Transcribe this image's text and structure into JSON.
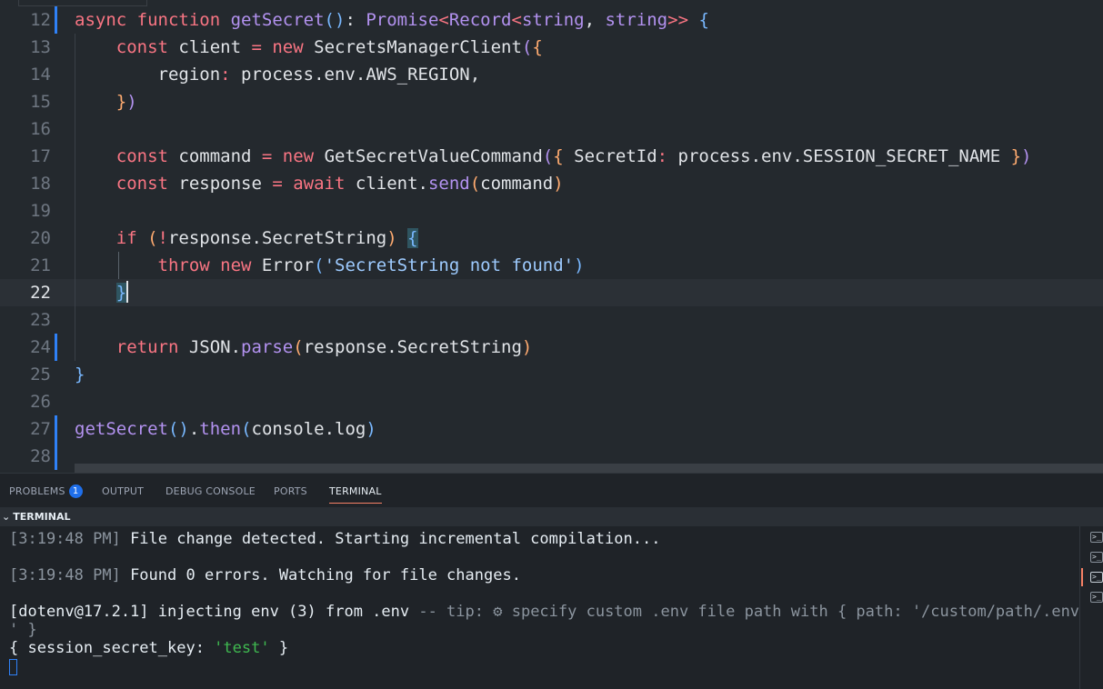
{
  "editor": {
    "current_line": "22",
    "lines": [
      {
        "num": "12",
        "tokens": [
          {
            "t": "async ",
            "c": "kw"
          },
          {
            "t": "function ",
            "c": "kw"
          },
          {
            "t": "getSecret",
            "c": "fn"
          },
          {
            "t": "()",
            "c": "b1"
          },
          {
            "t": ": ",
            "c": "var"
          },
          {
            "t": "Promise",
            "c": "ty"
          },
          {
            "t": "<",
            "c": "kw"
          },
          {
            "t": "Record",
            "c": "ty"
          },
          {
            "t": "<",
            "c": "kw"
          },
          {
            "t": "string",
            "c": "ty"
          },
          {
            "t": ", ",
            "c": "var"
          },
          {
            "t": "string",
            "c": "ty"
          },
          {
            "t": ">>",
            "c": "kw"
          },
          {
            "t": " ",
            "c": "var"
          },
          {
            "t": "{",
            "c": "b1"
          }
        ]
      },
      {
        "num": "13",
        "tokens": [
          {
            "t": "    const ",
            "c": "kw"
          },
          {
            "t": "client ",
            "c": "var"
          },
          {
            "t": "= ",
            "c": "kw"
          },
          {
            "t": "new ",
            "c": "kw"
          },
          {
            "t": "SecretsManagerClient",
            "c": "var"
          },
          {
            "t": "(",
            "c": "b2"
          },
          {
            "t": "{",
            "c": "b3"
          }
        ]
      },
      {
        "num": "14",
        "tokens": [
          {
            "t": "        region",
            "c": "var"
          },
          {
            "t": ": ",
            "c": "kw"
          },
          {
            "t": "process.env.AWS_REGION,",
            "c": "var"
          }
        ]
      },
      {
        "num": "15",
        "tokens": [
          {
            "t": "    ",
            "c": "var"
          },
          {
            "t": "}",
            "c": "b3"
          },
          {
            "t": ")",
            "c": "b2"
          }
        ]
      },
      {
        "num": "16",
        "tokens": []
      },
      {
        "num": "17",
        "tokens": [
          {
            "t": "    const ",
            "c": "kw"
          },
          {
            "t": "command ",
            "c": "var"
          },
          {
            "t": "= ",
            "c": "kw"
          },
          {
            "t": "new ",
            "c": "kw"
          },
          {
            "t": "GetSecretValueCommand",
            "c": "var"
          },
          {
            "t": "(",
            "c": "b2"
          },
          {
            "t": "{ ",
            "c": "b3"
          },
          {
            "t": "SecretId",
            "c": "var"
          },
          {
            "t": ": ",
            "c": "kw"
          },
          {
            "t": "process.env.SESSION_SECRET_NAME ",
            "c": "var"
          },
          {
            "t": "}",
            "c": "b3"
          },
          {
            "t": ")",
            "c": "b2"
          }
        ]
      },
      {
        "num": "18",
        "tokens": [
          {
            "t": "    const ",
            "c": "kw"
          },
          {
            "t": "response ",
            "c": "var"
          },
          {
            "t": "= ",
            "c": "kw"
          },
          {
            "t": "await ",
            "c": "kw"
          },
          {
            "t": "client.",
            "c": "var"
          },
          {
            "t": "send",
            "c": "fn"
          },
          {
            "t": "(",
            "c": "b3"
          },
          {
            "t": "command",
            "c": "var"
          },
          {
            "t": ")",
            "c": "b3"
          }
        ]
      },
      {
        "num": "19",
        "tokens": []
      },
      {
        "num": "20",
        "tokens": [
          {
            "t": "    if ",
            "c": "kw"
          },
          {
            "t": "(",
            "c": "b3"
          },
          {
            "t": "!",
            "c": "kw"
          },
          {
            "t": "response.SecretString",
            "c": "var"
          },
          {
            "t": ")",
            "c": "b3"
          },
          {
            "t": " ",
            "c": "var"
          },
          {
            "t": "{",
            "c": "cursorbox"
          }
        ]
      },
      {
        "num": "21",
        "tokens": [
          {
            "t": "        throw ",
            "c": "kw"
          },
          {
            "t": "new ",
            "c": "kw"
          },
          {
            "t": "Error",
            "c": "var"
          },
          {
            "t": "(",
            "c": "b1m"
          },
          {
            "t": "'SecretString not found'",
            "c": "str"
          },
          {
            "t": ")",
            "c": "b1m"
          }
        ]
      },
      {
        "num": "22",
        "tokens": [
          {
            "t": "    ",
            "c": "var"
          },
          {
            "t": "}",
            "c": "cursorbox"
          }
        ]
      },
      {
        "num": "23",
        "tokens": []
      },
      {
        "num": "24",
        "tokens": [
          {
            "t": "    return ",
            "c": "kw"
          },
          {
            "t": "JSON.",
            "c": "var"
          },
          {
            "t": "parse",
            "c": "fn"
          },
          {
            "t": "(",
            "c": "b3"
          },
          {
            "t": "response.SecretString",
            "c": "var"
          },
          {
            "t": ")",
            "c": "b3"
          }
        ]
      },
      {
        "num": "25",
        "tokens": [
          {
            "t": "}",
            "c": "b1"
          }
        ]
      },
      {
        "num": "26",
        "tokens": []
      },
      {
        "num": "27",
        "tokens": [
          {
            "t": "getSecret",
            "c": "fn"
          },
          {
            "t": "()",
            "c": "b1"
          },
          {
            "t": ".",
            "c": "var"
          },
          {
            "t": "then",
            "c": "fn"
          },
          {
            "t": "(",
            "c": "b1"
          },
          {
            "t": "console.log",
            "c": "var"
          },
          {
            "t": ")",
            "c": "b1"
          }
        ]
      },
      {
        "num": "28",
        "tokens": []
      }
    ],
    "modified_lines": [
      "12",
      "24",
      "27",
      "28"
    ]
  },
  "panel": {
    "tabs": [
      {
        "label": "PROBLEMS",
        "badge": "1",
        "active": false
      },
      {
        "label": "OUTPUT",
        "active": false
      },
      {
        "label": "DEBUG CONSOLE",
        "active": false
      },
      {
        "label": "PORTS",
        "active": false
      },
      {
        "label": "TERMINAL",
        "active": true
      }
    ],
    "section_title": "TERMINAL",
    "terminal": {
      "line1_ts": "[3:19:48 PM]",
      "line1_msg": " File change detected. Starting incremental compilation...",
      "line2_ts": "[3:19:48 PM]",
      "line2_msg": " Found 0 errors. Watching for file changes.",
      "line3_pre": "[dotenv@17.2.1] injecting env (3) from .env ",
      "line3_tip": "-- tip: ",
      "line3_gear": "⚙",
      "line3_rest": " specify custom .env file path with { path: '/custom/path/.env",
      "line4": "' }",
      "line5_pre": "{ session_secret_key: ",
      "line5_str": "'test'",
      "line5_post": " }"
    },
    "terminal_list_icon": ">_",
    "terminal_count": 4,
    "active_terminal_index": 2
  },
  "colors": {
    "accent": "#f78166",
    "badge": "#1f6feb",
    "git_modified": "#2f81f7"
  }
}
